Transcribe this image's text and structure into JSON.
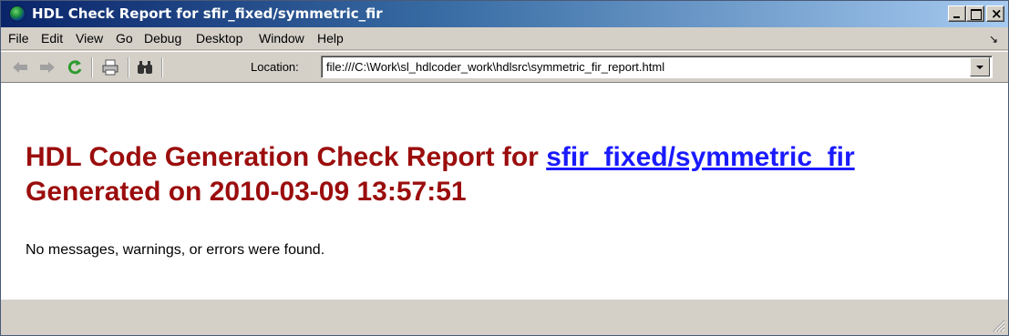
{
  "window": {
    "title": "HDL Check Report for sfir_fixed/symmetric_fir"
  },
  "menu": {
    "items": [
      "File",
      "Edit",
      "View",
      "Go",
      "Debug",
      "Desktop",
      "Window",
      "Help"
    ]
  },
  "toolbar": {
    "location_label": "Location:",
    "location_value": "file:///C:\\Work\\sl_hdlcoder_work\\hdlsrc\\symmetric_fir_report.html",
    "icons": [
      "back-arrow-icon",
      "forward-arrow-icon",
      "refresh-icon",
      "print-icon",
      "find-icon"
    ]
  },
  "report": {
    "heading_prefix": "HDL Code Generation Check Report for ",
    "heading_link": "sfir_fixed/symmetric_fir",
    "generated_line": "Generated on 2010-03-09 13:57:51",
    "message": "No messages, warnings, or errors were found."
  },
  "colors": {
    "heading": "#9b0d0d",
    "link": "#1a1aff",
    "titlebar_start": "#0a246a",
    "titlebar_end": "#a6caf0"
  }
}
